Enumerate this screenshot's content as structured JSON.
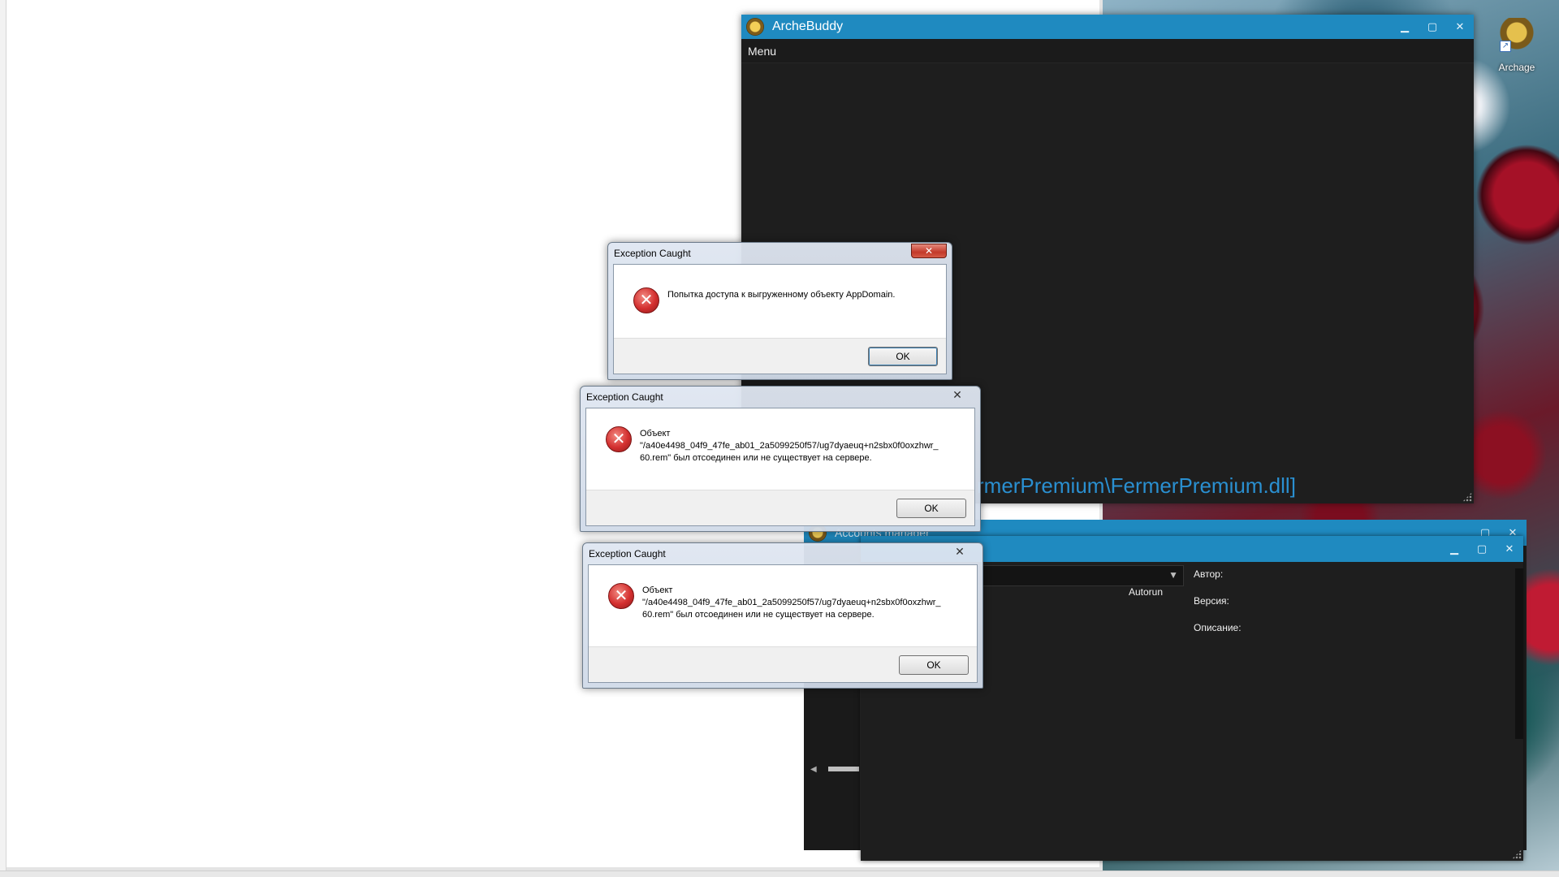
{
  "desktop": {
    "icon_label": "Archage"
  },
  "archebuddy": {
    "title": "ArcheBuddy",
    "menu": "Menu",
    "status_text": "rmerPremium\\FermerPremium.dll]"
  },
  "accounts_manager": {
    "title": "Accounts manager"
  },
  "plugins": {
    "col_autorun": "Autorun",
    "author_label": "Автор:",
    "version_label": "Версия:",
    "description_label": "Описание:"
  },
  "dialogs": [
    {
      "title": "Exception Caught",
      "message": "Попытка доступа к выгруженному объекту AppDomain.",
      "ok": "OK"
    },
    {
      "title": "Exception Caught",
      "message_line1": "Объект",
      "message_line2": "\"/a40e4498_04f9_47fe_ab01_2a5099250f57/ug7dyaeuq+n2sbx0f0oxzhwr_",
      "message_line3": "60.rem\" был отсоединен или не существует на сервере.",
      "ok": "OK"
    },
    {
      "title": "Exception Caught",
      "message_line1": "Объект",
      "message_line2": "\"/a40e4498_04f9_47fe_ab01_2a5099250f57/ug7dyaeuq+n2sbx0f0oxzhwr_",
      "message_line3": "60.rem\" был отсоединен или не существует на сервере.",
      "ok": "OK"
    }
  ],
  "colors": {
    "titlebar_blue": "#1f8ac0",
    "dark_bg": "#1e1e1e",
    "status_blue": "#2a8fd0"
  }
}
